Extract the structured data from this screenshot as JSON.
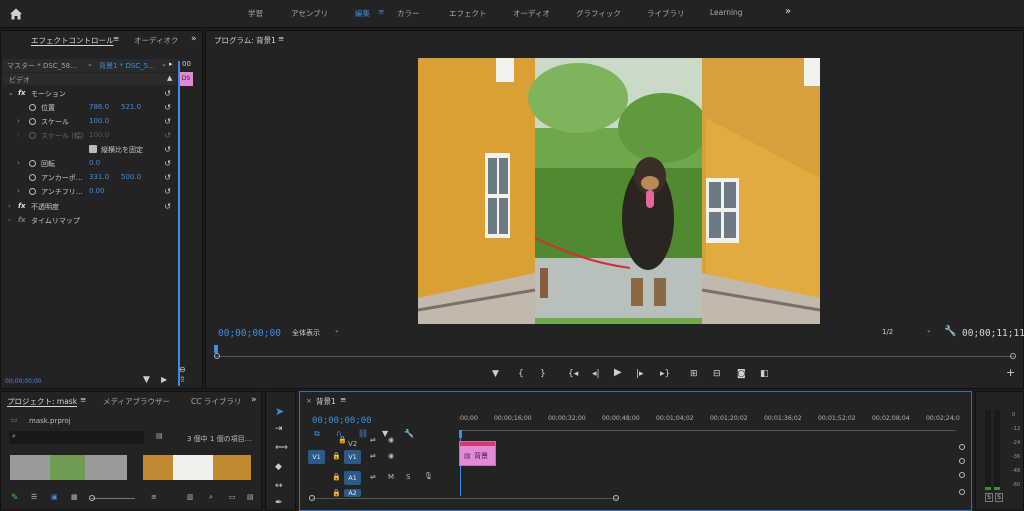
{
  "workspaces": [
    "学習",
    "アセンブリ",
    "編集",
    "カラー",
    "エフェクト",
    "オーディオ",
    "グラフィック",
    "ライブラリ",
    "Learning"
  ],
  "workspaces_more": "»",
  "effect_panel": {
    "tab_effect_controls": "エフェクトコントロール",
    "tab_audio": "オーディオク",
    "master_clip": "マスター * DSC_58…",
    "sequence_clip": "背景1 * DSC_5…",
    "mini_timecode": "00",
    "clip_label": "DS",
    "section_video": "ビデオ",
    "motion": "モーション",
    "position_label": "位置",
    "position_x": "786.0",
    "position_y": "521.0",
    "scale_label": "スケール",
    "scale_value": "100.0",
    "scale_w_label": "スケール (幅)",
    "scale_w_value": "100.0",
    "uniform_label": "縦横比を固定",
    "rotation_label": "回転",
    "rotation_value": "0.0",
    "anchor_label": "アンカーポ…",
    "anchor_x": "331.0",
    "anchor_y": "500.0",
    "antiflicker_label": "アンチフリ…",
    "antiflicker_value": "0.00",
    "opacity_label": "不透明度",
    "timeremap_label": "タイムリマップ",
    "footer_timecode": "00;00;00;00"
  },
  "program": {
    "title": "プログラム: 背景1",
    "timecode": "00;00;00;00",
    "fit": "全体表示",
    "resolution": "1/2",
    "duration": "00;00;11;11"
  },
  "project": {
    "tab_project": "プロジェクト: mask",
    "tab_media": "メディアブラウザー",
    "tab_cc": "CC ライブラリ",
    "file": "mask.prproj",
    "count": "3 個中 1 個の項目…"
  },
  "timeline": {
    "tab": "背景1",
    "timecode": "00;00;00;00",
    "ruler": [
      ":00;00",
      "00;00;16;00",
      "00;00;32;00",
      "00;00;48;00",
      "00;01;04;02",
      "00;01;20;02",
      "00;01;36;02",
      "00;01;52;02",
      "00;02;08;04",
      "00;02;24;0"
    ],
    "track_v2": "V2",
    "track_v1": "V1",
    "track_a1": "A1",
    "track_a2": "A2",
    "src_v1": "V1",
    "mute": "M",
    "solo": "S",
    "clip_name": "背景"
  },
  "audio_meter": {
    "scale": [
      "0",
      "-12",
      "-24",
      "-36",
      "-48",
      "-60"
    ],
    "solo_left": "S",
    "solo_right": "S"
  },
  "colors": {
    "accent": "#3b8ee0",
    "clip_pink": "#e289d8",
    "track_blue": "#2c5a86"
  }
}
